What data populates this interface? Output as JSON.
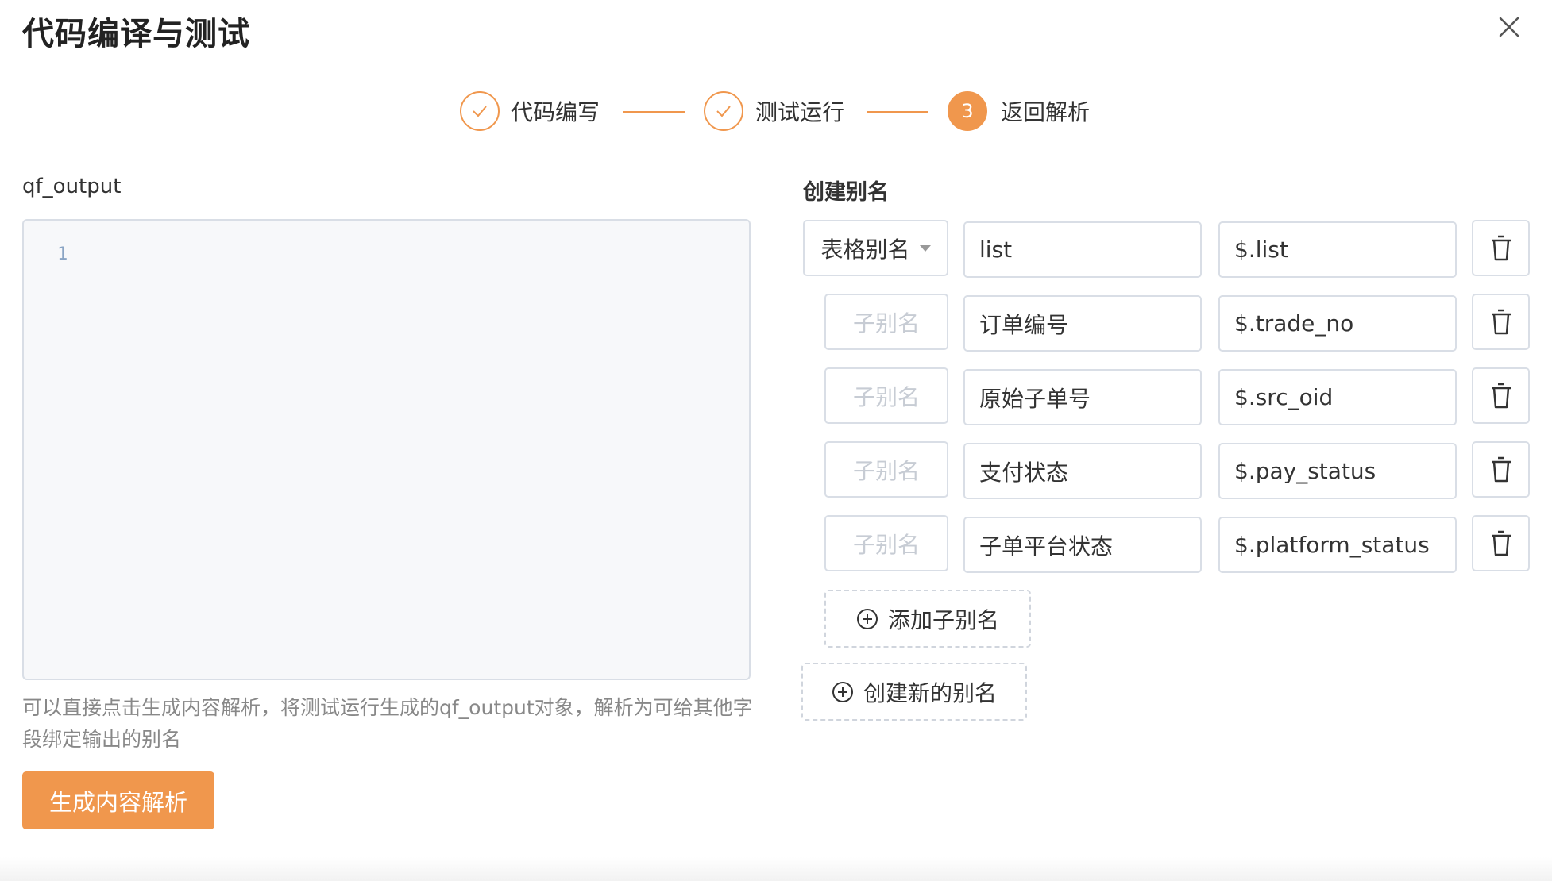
{
  "dialog": {
    "title": "代码编译与测试",
    "close_icon": "close-icon"
  },
  "steps": [
    {
      "label": "代码编写",
      "state": "done",
      "icon": "check-icon"
    },
    {
      "label": "测试运行",
      "state": "done",
      "icon": "check-icon"
    },
    {
      "label": "返回解析",
      "state": "active",
      "number": "3"
    }
  ],
  "colors": {
    "accent": "#f0974d",
    "border": "#d9dee6",
    "editor_bg": "#f7f8fa",
    "hint": "#888888",
    "placeholder": "#c7ccd4"
  },
  "left": {
    "label": "qf_output",
    "editor_line_number": "1",
    "hint": "可以直接点击生成内容解析，将测试运行生成的qf_output对象，解析为可给其他字段绑定输出的别名",
    "generate_button": "生成内容解析"
  },
  "right": {
    "label": "创建别名",
    "main_alias": {
      "type": "表格别名",
      "name": "list",
      "path": "$.list"
    },
    "sub_aliases": [
      {
        "placeholder": "子别名",
        "name": "订单编号",
        "path": "$.trade_no"
      },
      {
        "placeholder": "子别名",
        "name": "原始子单号",
        "path": "$.src_oid"
      },
      {
        "placeholder": "子别名",
        "name": "支付状态",
        "path": "$.pay_status"
      },
      {
        "placeholder": "子别名",
        "name": "子单平台状态",
        "path": "$.platform_status"
      }
    ],
    "add_sub_alias": "添加子别名",
    "create_alias": "创建新的别名"
  }
}
